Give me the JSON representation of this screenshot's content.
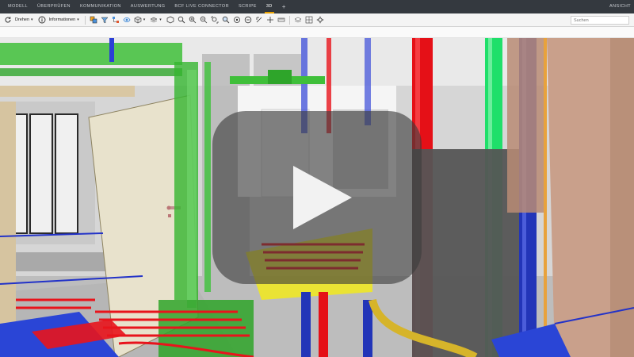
{
  "nav": {
    "tabs": [
      {
        "label": "MODELL"
      },
      {
        "label": "ÜBERPRÜFEN"
      },
      {
        "label": "KOMMUNIKATION"
      },
      {
        "label": "AUSWERTUNG"
      },
      {
        "label": "BCF LIVE CONNECTOR"
      },
      {
        "label": "SCRIPE"
      },
      {
        "label": "3D"
      }
    ],
    "active_tab": "3D",
    "plus": "+",
    "right_label": "ANSICHT"
  },
  "toolbar": {
    "rotate_label": "Drehen",
    "info_label": "Informationen",
    "caret": "▾",
    "search_placeholder": "Suchen"
  },
  "colors": {
    "nav_bg": "#34393f",
    "active_accent": "#e8a100",
    "pipe_red": "#e8141c",
    "pipe_green": "#22e06c",
    "pipe_blue": "#2b3fd6",
    "pipe_yellow": "#f2ea1c",
    "wall_brown": "#c8a28e"
  },
  "video": {
    "play_icon": "play-icon"
  }
}
